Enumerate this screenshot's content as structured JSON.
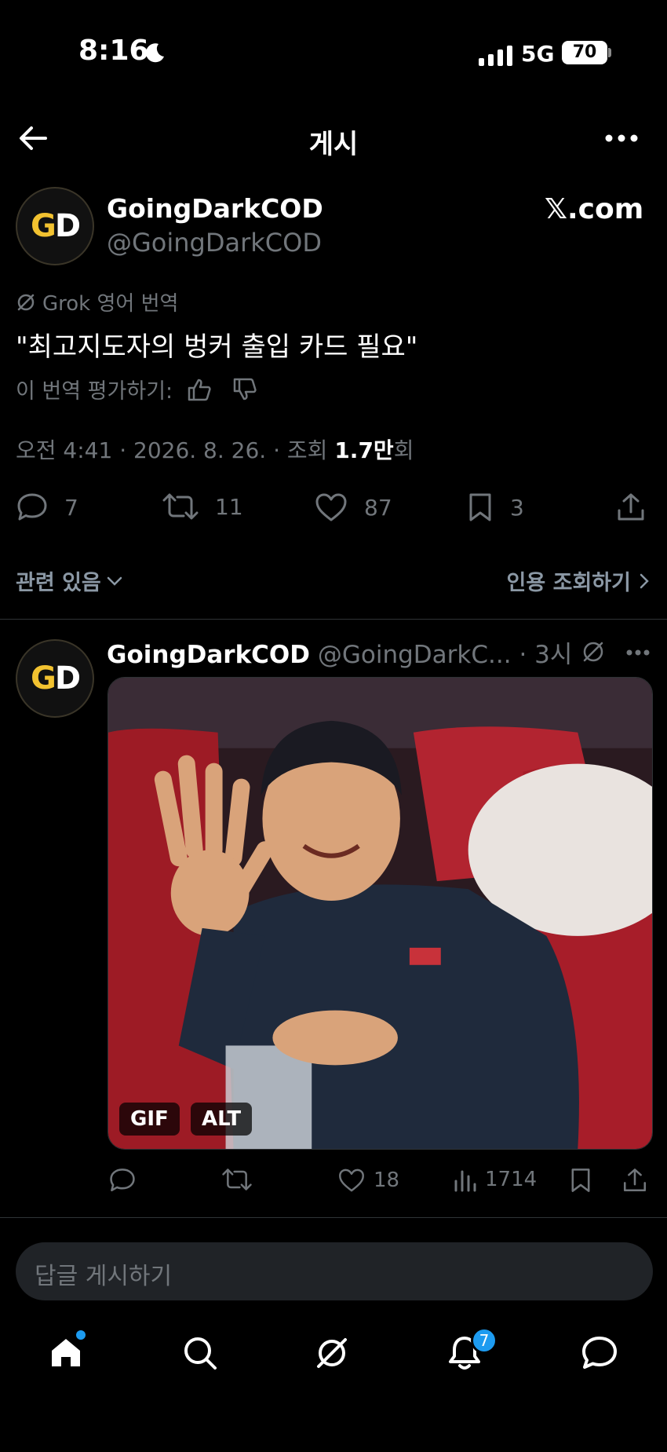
{
  "status_bar": {
    "time": "8:16",
    "network": "5G",
    "battery": "70"
  },
  "header": {
    "title": "게시"
  },
  "author": {
    "avatar_text_g": "G",
    "avatar_text_d": "D",
    "name": "GoingDarkCOD",
    "handle": "@GoingDarkCOD",
    "domain": "𝕏.com"
  },
  "translation": {
    "label": "Grok 영어 번역",
    "text": "\"최고지도자의 벙커 출입 카드 필요\"",
    "rate_label": "이 번역 평가하기:"
  },
  "meta": {
    "prefix": "오전 4:41 · 2026. 8. 26. · 조회 ",
    "views": "1.7만",
    "suffix": "회"
  },
  "actions": {
    "replies": "7",
    "reposts": "11",
    "likes": "87",
    "bookmarks": "3"
  },
  "links": {
    "related": "관련 있음",
    "quote_views": "인용 조회하기"
  },
  "reply": {
    "name": "GoingDarkCOD",
    "handle_time": " @GoingDarkC... · 3시",
    "badges": {
      "gif": "GIF",
      "alt": "ALT"
    },
    "likes": "18",
    "views": "1714"
  },
  "composer": {
    "placeholder": "답글 게시하기"
  },
  "nav": {
    "notifications_count": "7"
  },
  "colors": {
    "accent": "#1d9bf0",
    "background": "#000000",
    "muted": "#71767b",
    "avatar_gold": "#f2c230"
  }
}
